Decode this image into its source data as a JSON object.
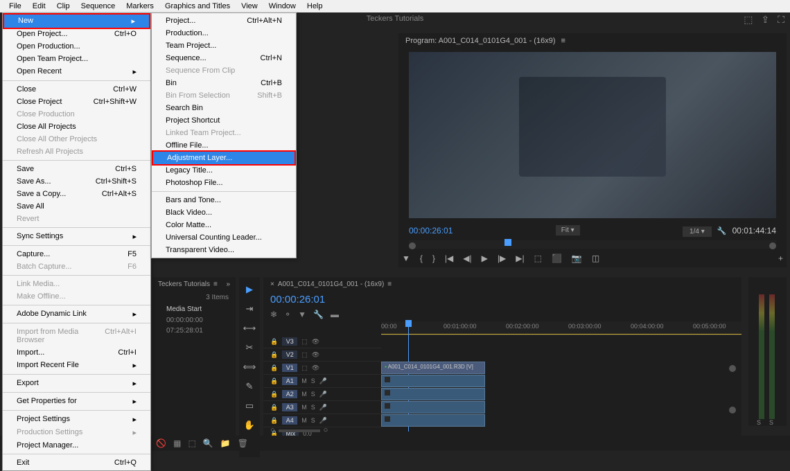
{
  "menubar": [
    "File",
    "Edit",
    "Clip",
    "Sequence",
    "Markers",
    "Graphics and Titles",
    "View",
    "Window",
    "Help"
  ],
  "project_tab": "Teckers Tutorials",
  "file_menu": {
    "new": "New",
    "open_project": {
      "label": "Open Project...",
      "shortcut": "Ctrl+O"
    },
    "open_production": "Open Production...",
    "open_team_project": "Open Team Project...",
    "open_recent": "Open Recent",
    "close": {
      "label": "Close",
      "shortcut": "Ctrl+W"
    },
    "close_project": {
      "label": "Close Project",
      "shortcut": "Ctrl+Shift+W"
    },
    "close_production": "Close Production",
    "close_all_projects": "Close All Projects",
    "close_all_other": "Close All Other Projects",
    "refresh_all": "Refresh All Projects",
    "save": {
      "label": "Save",
      "shortcut": "Ctrl+S"
    },
    "save_as": {
      "label": "Save As...",
      "shortcut": "Ctrl+Shift+S"
    },
    "save_copy": {
      "label": "Save a Copy...",
      "shortcut": "Ctrl+Alt+S"
    },
    "save_all": "Save All",
    "revert": "Revert",
    "sync_settings": "Sync Settings",
    "capture": {
      "label": "Capture...",
      "shortcut": "F5"
    },
    "batch_capture": {
      "label": "Batch Capture...",
      "shortcut": "F6"
    },
    "link_media": "Link Media...",
    "make_offline": "Make Offline...",
    "adobe_dynamic_link": "Adobe Dynamic Link",
    "import_browser": {
      "label": "Import from Media Browser",
      "shortcut": "Ctrl+Alt+I"
    },
    "import": {
      "label": "Import...",
      "shortcut": "Ctrl+I"
    },
    "import_recent": "Import Recent File",
    "export": "Export",
    "get_properties": "Get Properties for",
    "project_settings": "Project Settings",
    "production_settings": "Production Settings",
    "project_manager": "Project Manager...",
    "exit": {
      "label": "Exit",
      "shortcut": "Ctrl+Q"
    }
  },
  "new_menu": {
    "project": {
      "label": "Project...",
      "shortcut": "Ctrl+Alt+N"
    },
    "production": "Production...",
    "team_project": "Team Project...",
    "sequence": {
      "label": "Sequence...",
      "shortcut": "Ctrl+N"
    },
    "sequence_from_clip": "Sequence From Clip",
    "bin": {
      "label": "Bin",
      "shortcut": "Ctrl+B"
    },
    "bin_from_selection": {
      "label": "Bin From Selection",
      "shortcut": "Shift+B"
    },
    "search_bin": "Search Bin",
    "project_shortcut": "Project Shortcut",
    "linked_team_project": "Linked Team Project...",
    "offline_file": "Offline File...",
    "adjustment_layer": "Adjustment Layer...",
    "legacy_title": "Legacy Title...",
    "photoshop_file": "Photoshop File...",
    "bars_tone": "Bars and Tone...",
    "black_video": "Black Video...",
    "color_matte": "Color Matte...",
    "universal_counting": "Universal Counting Leader...",
    "transparent_video": "Transparent Video..."
  },
  "program": {
    "title": "Program: A001_C014_0101G4_001 - (16x9)",
    "timecode_current": "00:00:26:01",
    "fit": "Fit",
    "scale": "1/4",
    "timecode_duration": "00:01:44:14"
  },
  "project": {
    "panel_title": "Teckers Tutorials",
    "items_count": "3 Items",
    "media_start_header": "Media Start",
    "rows": [
      "00:00:00:00",
      "07:25:28:01"
    ]
  },
  "timeline": {
    "sequence_name": "A001_C014_0101G4_001 - (16x9)",
    "timecode": "00:00:26:01",
    "ruler": [
      "00:00",
      "00:01:00:00",
      "00:02:00:00",
      "00:03:00:00",
      "00:04:00:00",
      "00:05:00:00"
    ],
    "tracks": {
      "v3": "V3",
      "v2": "V2",
      "v1": "V1",
      "a1": "A1",
      "a2": "A2",
      "a3": "A3",
      "a4": "A4",
      "mix": "Mix"
    },
    "clip_name": "A001_C014_0101G4_001.R3D [V]",
    "mix_value": "0.0",
    "m": "M",
    "s": "S"
  },
  "meters": {
    "s1": "S",
    "s2": "S"
  }
}
